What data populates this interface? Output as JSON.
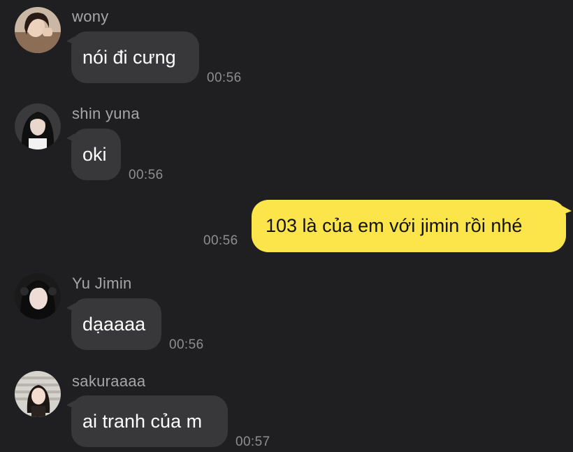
{
  "messages": [
    {
      "sender": "wony",
      "text": "nói đi cưng",
      "time": "00:56"
    },
    {
      "sender": "shin yuna",
      "text": "oki",
      "time": "00:56"
    },
    {
      "sender": "",
      "text": "103 là của em với jimin rồi nhé",
      "time": "00:56"
    },
    {
      "sender": "Yu Jimin",
      "text": "dạaaaa",
      "time": "00:56"
    },
    {
      "sender": "sakuraaaa",
      "text": "ai tranh của m",
      "time": "00:57"
    }
  ],
  "colors": {
    "background": "#1f1f21",
    "incoming_bubble": "#38383a",
    "outgoing_bubble": "#fbe54b",
    "sender_name": "#a6a6a8",
    "timestamp": "#8e8e90"
  }
}
